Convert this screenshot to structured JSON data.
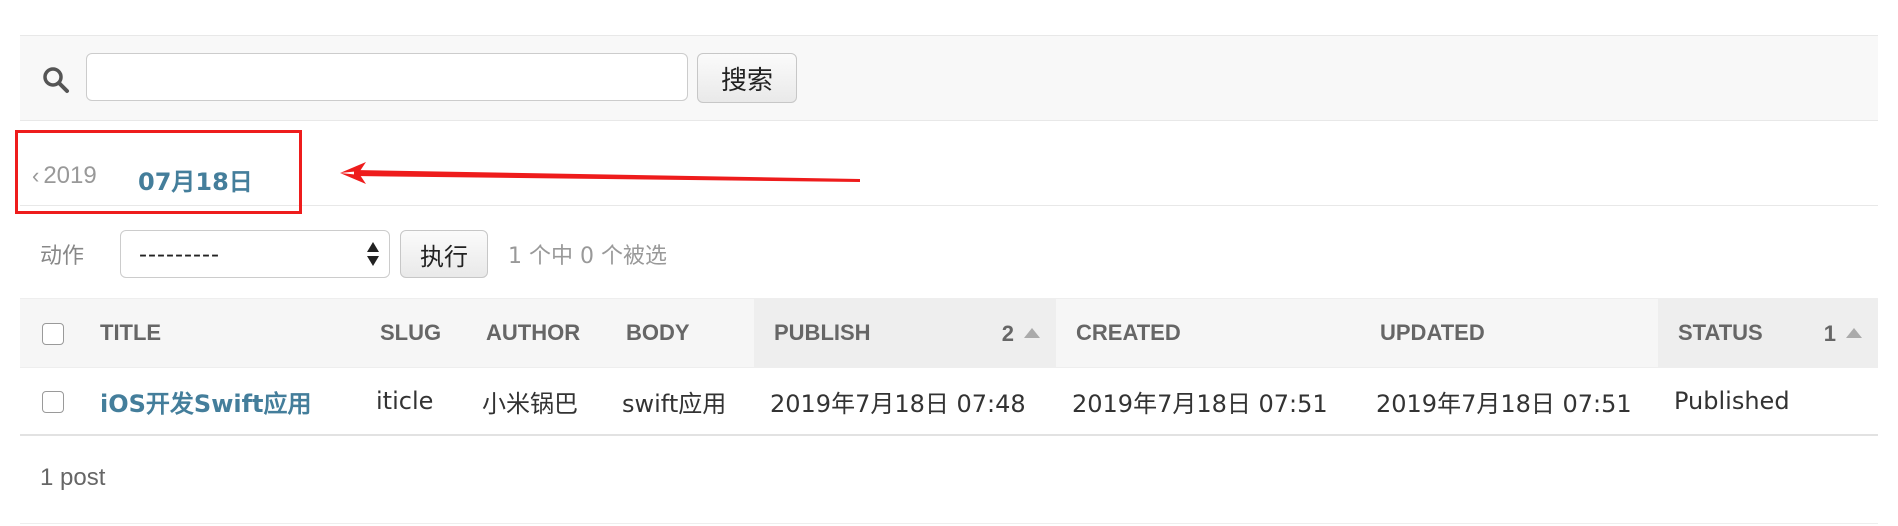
{
  "search": {
    "value": "",
    "placeholder": "",
    "button_label": "搜索"
  },
  "date_hierarchy": {
    "back_chevron": "‹",
    "back_label": "2019",
    "current_label": "07月18日"
  },
  "actions": {
    "label": "动作",
    "selected_value": "---------",
    "run_button_label": "执行",
    "counter_text": "1 个中 0 个被选"
  },
  "table": {
    "columns": [
      {
        "label": "TITLE",
        "sort_priority": ""
      },
      {
        "label": "SLUG",
        "sort_priority": ""
      },
      {
        "label": "AUTHOR",
        "sort_priority": ""
      },
      {
        "label": "BODY",
        "sort_priority": ""
      },
      {
        "label": "PUBLISH",
        "sort_priority": "2"
      },
      {
        "label": "CREATED",
        "sort_priority": ""
      },
      {
        "label": "UPDATED",
        "sort_priority": ""
      },
      {
        "label": "STATUS",
        "sort_priority": "1"
      }
    ],
    "rows": [
      {
        "title": "iOS开发Swift应用",
        "slug": "iticle",
        "author": "小米锅巴",
        "body": "swift应用",
        "publish": "2019年7月18日 07:48",
        "created": "2019年7月18日 07:51",
        "updated": "2019年7月18日 07:51",
        "status": "Published"
      }
    ]
  },
  "paginator": {
    "text": "1 post"
  },
  "colors": {
    "link": "#447e9b",
    "annotation": "#ee1c1c"
  }
}
